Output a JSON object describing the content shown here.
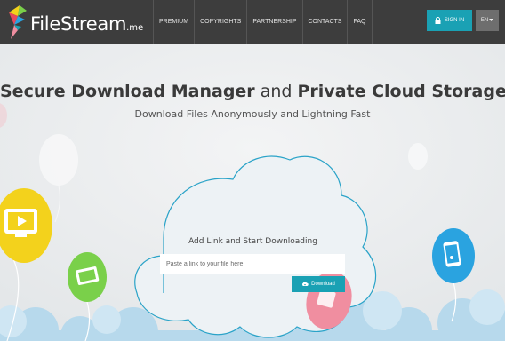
{
  "brand": {
    "name": "FileStream",
    "tld": ".me"
  },
  "nav": {
    "items": [
      {
        "label": "PREMIUM"
      },
      {
        "label": "COPYRIGHTS"
      },
      {
        "label": "PARTNERSHIP"
      },
      {
        "label": "CONTACTS"
      },
      {
        "label": "FAQ"
      }
    ],
    "signin_label": "SIGN IN",
    "lang_label": "EN"
  },
  "hero": {
    "title_part1": "Secure Download Manager",
    "title_and": " and ",
    "title_part2": "Private Cloud Storage",
    "subtitle": "Download Files Anonymously and Lightning Fast"
  },
  "downloader": {
    "title": "Add Link and Start Downloading",
    "input_placeholder": "Paste a link to your file here",
    "input_value": "",
    "button_label": "Download"
  },
  "icons": [
    "logo-bird-icon",
    "lock-icon",
    "caret-down-icon",
    "video-balloon-icon",
    "image-balloon-icon",
    "phone-music-balloon-icon",
    "cloud-download-icon"
  ],
  "colors": {
    "header_bg": "#3d3d3d",
    "accent": "#1aa1b4",
    "lang_bg": "#6e6e6e",
    "page_bg": "#ebedee",
    "balloon_yellow": "#f3d21c",
    "balloon_green": "#7ad04a",
    "balloon_blue": "#2aa3e0",
    "balloon_pink": "#f08ea0"
  }
}
